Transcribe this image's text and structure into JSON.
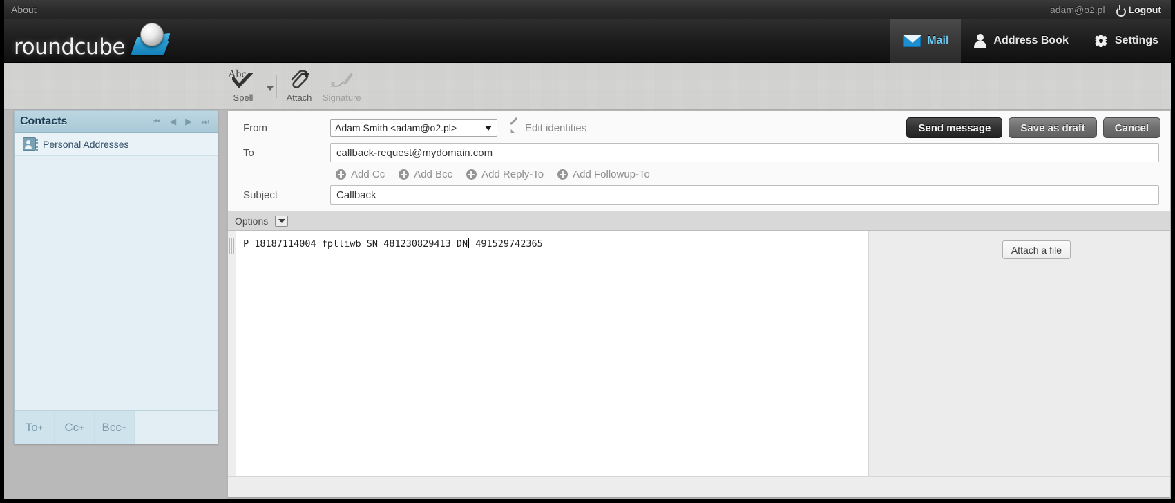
{
  "topbar": {
    "about_label": "About",
    "user_email": "adam@o2.pl",
    "logout_label": "Logout",
    "power_icon": "power-icon"
  },
  "header": {
    "logo_text": "roundcube",
    "nav": [
      {
        "label": "Mail",
        "icon": "mail-icon",
        "active": true
      },
      {
        "label": "Address Book",
        "icon": "person-icon",
        "active": false
      },
      {
        "label": "Settings",
        "icon": "gear-icon",
        "active": false
      }
    ]
  },
  "toolbar": {
    "spell_label": "Spell",
    "spell_icon_text": "Abc",
    "attach_label": "Attach",
    "signature_label": "Signature"
  },
  "contacts": {
    "title": "Contacts",
    "pager": {
      "first": "⏮",
      "prev": "◀",
      "next": "▶",
      "last": "⏭"
    },
    "sources": [
      {
        "label": "Personal Addresses",
        "icon": "address-book-icon"
      }
    ],
    "footer_buttons": [
      {
        "label": "To",
        "sup": "+"
      },
      {
        "label": "Cc",
        "sup": "+"
      },
      {
        "label": "Bcc",
        "sup": "+"
      }
    ]
  },
  "compose": {
    "from": {
      "label": "From",
      "selected": "Adam Smith <adam@o2.pl>",
      "options": [
        "Adam Smith <adam@o2.pl>"
      ],
      "edit_identities_label": "Edit identities"
    },
    "to": {
      "label": "To",
      "value": "callback-request@mydomain.com",
      "placeholder": ""
    },
    "subject": {
      "label": "Subject",
      "value": "Callback",
      "placeholder": ""
    },
    "add_links": [
      {
        "label": "Add Cc"
      },
      {
        "label": "Add Bcc"
      },
      {
        "label": "Add Reply-To"
      },
      {
        "label": "Add Followup-To"
      }
    ],
    "actions": {
      "send_label": "Send message",
      "draft_label": "Save as draft",
      "cancel_label": "Cancel"
    },
    "options": {
      "label": "Options"
    },
    "body": {
      "text_before_caret": "P 18187114004 fplliwb SN 481230829413 DN",
      "text_after_caret": " 491529742365",
      "full_text": "P 18187114004 fplliwb SN 481230829413 DN 491529742365"
    },
    "attach": {
      "button_label": "Attach a file"
    }
  },
  "colors": {
    "accent_blue": "#6ec9f2",
    "logo_cube": "#1580ba",
    "panel_bg": "#f5f5f5",
    "contacts_bg": "#ddeaf0",
    "contacts_header": "#a9c9d8",
    "dark_chrome": "#1b1b1b"
  }
}
